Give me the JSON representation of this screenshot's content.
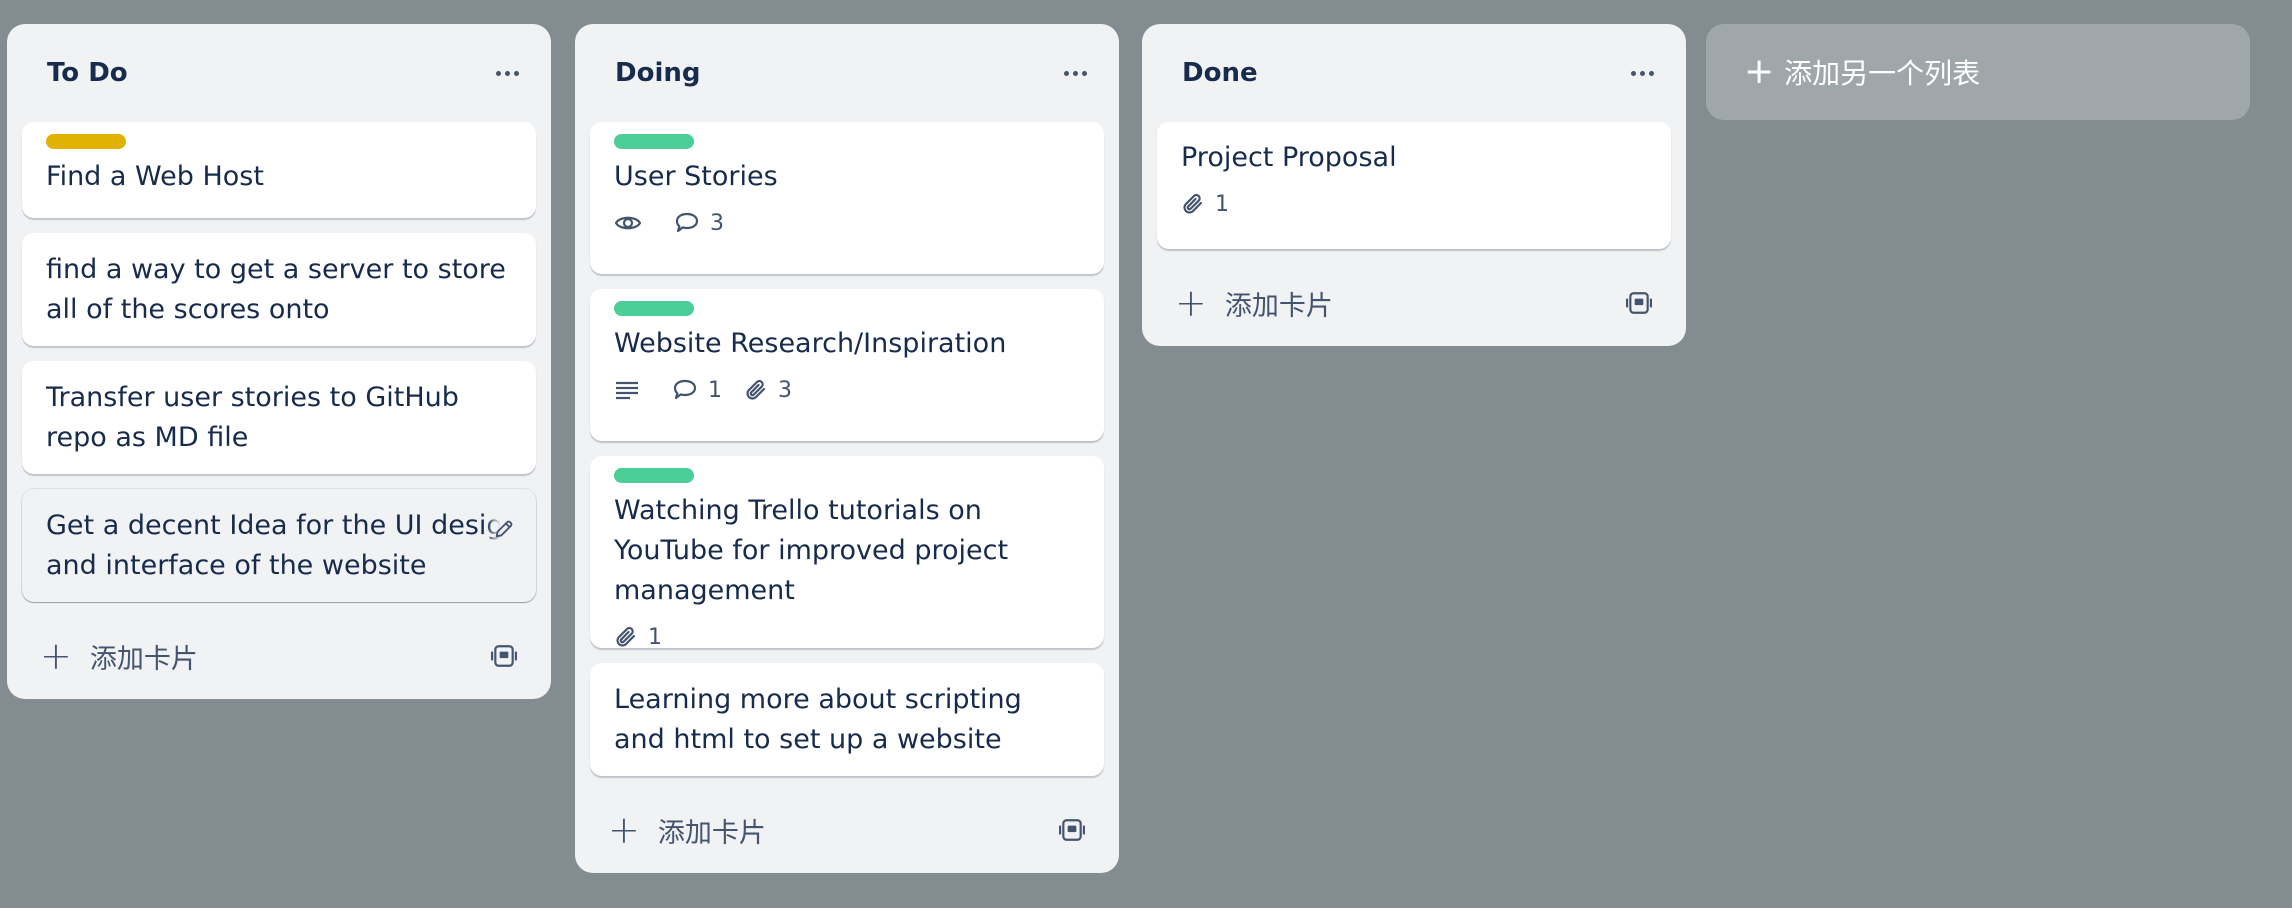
{
  "colors": {
    "board_bg": "#838c91",
    "label_yellow": "#e2b203",
    "label_green": "#4bce97"
  },
  "lists": [
    {
      "title": "To Do",
      "cards": [
        {
          "title": "Find a Web Host",
          "label": "label_yellow"
        },
        {
          "title": "find a way to get a server to store all of the scores onto"
        },
        {
          "title": "Transfer user stories to GitHub repo as MD file"
        },
        {
          "title": "Get a decent Idea for the UI design and interface of the website"
        }
      ],
      "add_card": "添加卡片"
    },
    {
      "title": "Doing",
      "cards": [
        {
          "title": "User Stories",
          "label": "label_green",
          "badges": {
            "comments": "3"
          }
        },
        {
          "title": "Website Research/Inspiration",
          "label": "label_green",
          "badges": {
            "comments": "1",
            "attachments": "3"
          }
        },
        {
          "title": "Watching Trello tutorials on YouTube for improved project management",
          "label": "label_green",
          "badges": {
            "attachments": "1"
          }
        },
        {
          "title": "Learning more about scripting and html to set up a website"
        }
      ],
      "add_card": "添加卡片"
    },
    {
      "title": "Done",
      "cards": [
        {
          "title": "Project Proposal",
          "badges": {
            "attachments": "1"
          }
        }
      ],
      "add_card": "添加卡片"
    }
  ],
  "add_list": "添加另一个列表"
}
